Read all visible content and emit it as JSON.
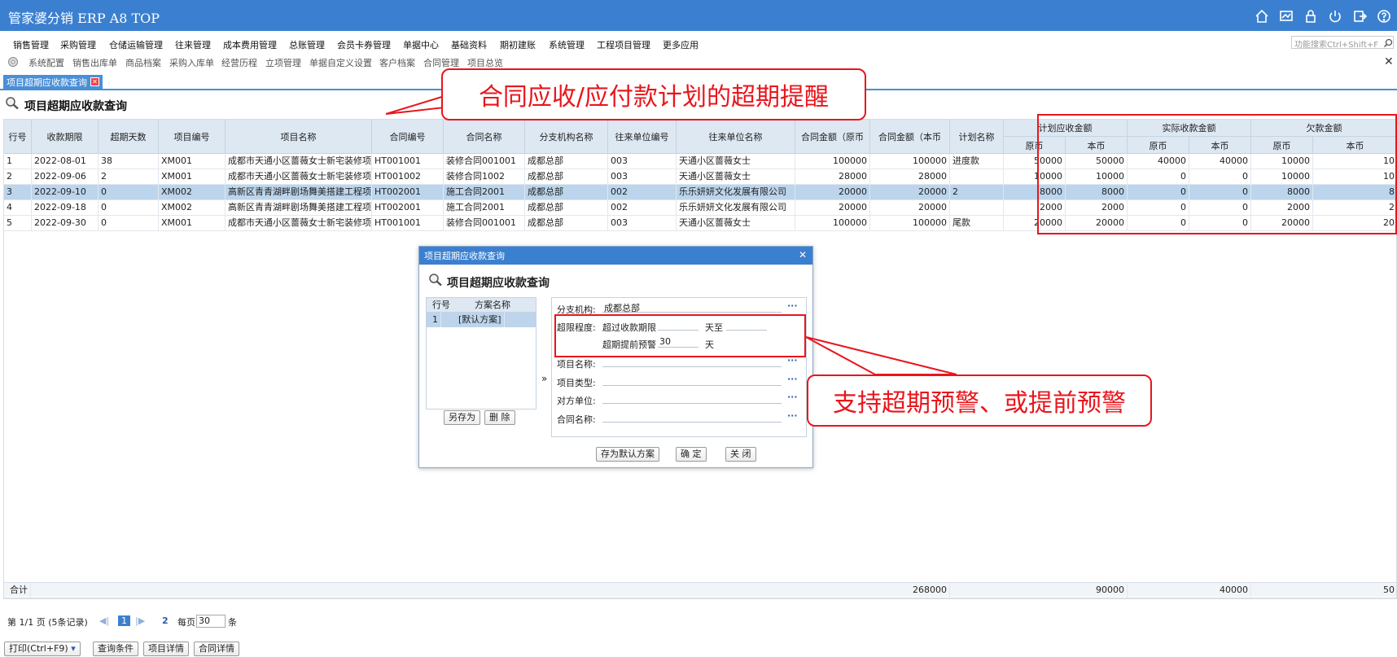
{
  "app": {
    "title": "管家婆分销 ERP A8 TOP"
  },
  "menu": [
    "销售管理",
    "采购管理",
    "仓储运输管理",
    "往来管理",
    "成本费用管理",
    "总账管理",
    "会员卡券管理",
    "单据中心",
    "基础资料",
    "期初建账",
    "系统管理",
    "工程项目管理",
    "更多应用"
  ],
  "func_search": {
    "placeholder": "功能搜索Ctrl+Shift+F"
  },
  "quick": [
    "系统配置",
    "销售出库单",
    "商品档案",
    "采购入库单",
    "经营历程",
    "立项管理",
    "单据自定义设置",
    "客户档案",
    "合同管理",
    "项目总览"
  ],
  "tab": {
    "label": "项目超期应收款查询"
  },
  "page": {
    "title": "项目超期应收款查询"
  },
  "grid": {
    "headers": [
      "行号",
      "收款期限",
      "超期天数",
      "项目编号",
      "项目名称",
      "合同编号",
      "合同名称",
      "分支机构名称",
      "往来单位编号",
      "往来单位名称",
      "合同金额（原币",
      "合同金额（本币",
      "计划名称"
    ],
    "groups": [
      "计划应收金额",
      "实际收款金额",
      "欠款金额"
    ],
    "sub": [
      "原币",
      "本币"
    ],
    "rows": [
      [
        "1",
        "2022-08-01",
        "38",
        "XM001",
        "成都市天通小区蔷薇女士新宅装修项",
        "HT001001",
        "装修合同001001",
        "成都总部",
        "003",
        "天通小区蔷薇女士",
        "100000",
        "100000",
        "进度款",
        "50000",
        "50000",
        "40000",
        "40000",
        "10000",
        "10"
      ],
      [
        "2",
        "2022-09-06",
        "2",
        "XM001",
        "成都市天通小区蔷薇女士新宅装修项",
        "HT001002",
        "装修合同1002",
        "成都总部",
        "003",
        "天通小区蔷薇女士",
        "28000",
        "28000",
        "",
        "10000",
        "10000",
        "0",
        "0",
        "10000",
        "10"
      ],
      [
        "3",
        "2022-09-10",
        "0",
        "XM002",
        "高新区青青湖畔剧场舞美搭建工程项",
        "HT002001",
        "施工合同2001",
        "成都总部",
        "002",
        "乐乐妍妍文化发展有限公司",
        "20000",
        "20000",
        "2",
        "8000",
        "8000",
        "0",
        "0",
        "8000",
        "8"
      ],
      [
        "4",
        "2022-09-18",
        "0",
        "XM002",
        "高新区青青湖畔剧场舞美搭建工程项",
        "HT002001",
        "施工合同2001",
        "成都总部",
        "002",
        "乐乐妍妍文化发展有限公司",
        "20000",
        "20000",
        "",
        "2000",
        "2000",
        "0",
        "0",
        "2000",
        "2"
      ],
      [
        "5",
        "2022-09-30",
        "0",
        "XM001",
        "成都市天通小区蔷薇女士新宅装修项",
        "HT001001",
        "装修合同001001",
        "成都总部",
        "003",
        "天通小区蔷薇女士",
        "100000",
        "100000",
        "尾款",
        "20000",
        "20000",
        "0",
        "0",
        "20000",
        "20"
      ]
    ],
    "selected_row": 2,
    "total": {
      "label": "合计",
      "contract_local": "268000",
      "plan_local": "90000",
      "actual_local": "40000",
      "owed": "50"
    }
  },
  "pager": {
    "page_info": "第 1/1 页 (5条记录)",
    "current": "1",
    "next": "2",
    "per_page_label": "每页",
    "per_page": "30",
    "unit": "条"
  },
  "bottom_buttons": {
    "print": "打印(Ctrl+F9)",
    "query": "查询条件",
    "project_detail": "项目详情",
    "contract_detail": "合同详情"
  },
  "dialog": {
    "header": "项目超期应收款查询",
    "title": "项目超期应收款查询",
    "scheme_headers": [
      "行号",
      "方案名称"
    ],
    "scheme_rows": [
      [
        "1",
        "[默认方案]"
      ]
    ],
    "save_as": "另存为",
    "delete": "删 除",
    "branch_label": "分支机构:",
    "branch_value": "成都总部",
    "overdue_label": "超限程度:",
    "overdue_exceed": "超过收款期限",
    "day_to": "天至",
    "advance_label": "超期提前预警",
    "advance_value": "30",
    "day": "天",
    "project_name": "项目名称:",
    "project_type": "项目类型:",
    "counterparty": "对方单位:",
    "contract_name": "合同名称:",
    "save_default": "存为默认方案",
    "ok": "确 定",
    "close": "关 闭"
  },
  "annotations": {
    "callout1": "合同应收/应付款计划的超期提醒",
    "callout2": "支持超期预警、或提前预警"
  },
  "colors": {
    "header_blue": "#3b80d0",
    "annotation_red": "#e8161c",
    "selected_row": "#bcd5ec"
  }
}
